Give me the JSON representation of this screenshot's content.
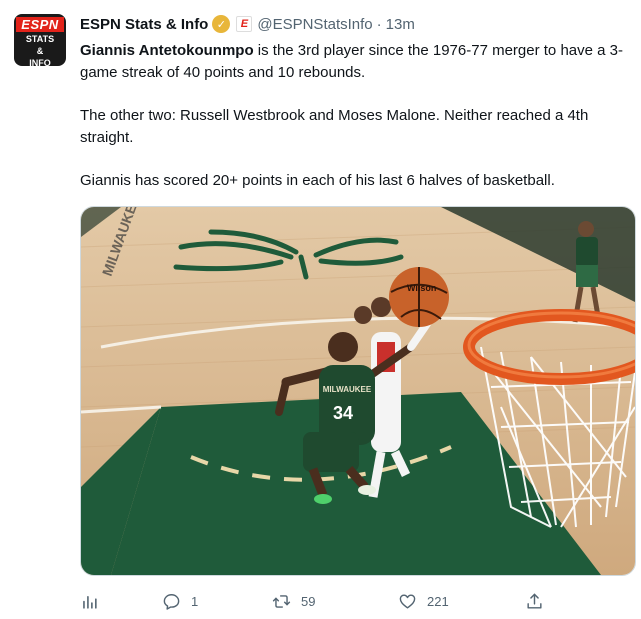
{
  "account": {
    "name": "ESPN Stats & Info",
    "handle": "@ESPNStatsInfo",
    "separator": "·",
    "time": "13m",
    "avatar": {
      "logo_text": "ESPN",
      "line1": "STATS",
      "line2": "&",
      "line3": "INFO"
    },
    "affiliate_badge": "E"
  },
  "tweet": {
    "p1_bold": "Giannis Antetokounmpo",
    "p1_rest": " is the 3rd player since the 1976-77 merger to have a 3-game streak of 40 points and 10 rebounds.",
    "p2": "The other two: Russell Westbrook and Moses Malone. Neither reached a 4th straight.",
    "p3": "Giannis has scored 20+ points in each of his last 6 halves of basketball."
  },
  "media": {
    "jersey_number": "34",
    "jersey_text": "MILWAUKEE",
    "ball_text": "Wilson"
  },
  "actions": {
    "replies": "1",
    "retweets": "59",
    "likes": "221"
  },
  "colors": {
    "court_green": "#1f5b3a",
    "court_wood": "#d6b48c",
    "rim_orange": "#e2571f",
    "text_secondary": "#536471",
    "verified_gold": "#e8b63a"
  },
  "icons": [
    "analytics-icon",
    "reply-icon",
    "retweet-icon",
    "like-icon",
    "share-icon",
    "verified-icon"
  ]
}
